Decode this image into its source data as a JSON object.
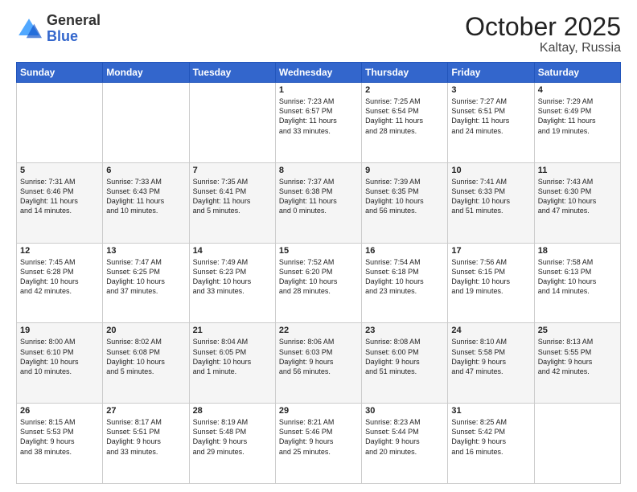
{
  "logo": {
    "general": "General",
    "blue": "Blue"
  },
  "header": {
    "month": "October 2025",
    "location": "Kaltay, Russia"
  },
  "days": [
    "Sunday",
    "Monday",
    "Tuesday",
    "Wednesday",
    "Thursday",
    "Friday",
    "Saturday"
  ],
  "weeks": [
    [
      {
        "day": "",
        "content": ""
      },
      {
        "day": "",
        "content": ""
      },
      {
        "day": "",
        "content": ""
      },
      {
        "day": "1",
        "content": "Sunrise: 7:23 AM\nSunset: 6:57 PM\nDaylight: 11 hours\nand 33 minutes."
      },
      {
        "day": "2",
        "content": "Sunrise: 7:25 AM\nSunset: 6:54 PM\nDaylight: 11 hours\nand 28 minutes."
      },
      {
        "day": "3",
        "content": "Sunrise: 7:27 AM\nSunset: 6:51 PM\nDaylight: 11 hours\nand 24 minutes."
      },
      {
        "day": "4",
        "content": "Sunrise: 7:29 AM\nSunset: 6:49 PM\nDaylight: 11 hours\nand 19 minutes."
      }
    ],
    [
      {
        "day": "5",
        "content": "Sunrise: 7:31 AM\nSunset: 6:46 PM\nDaylight: 11 hours\nand 14 minutes."
      },
      {
        "day": "6",
        "content": "Sunrise: 7:33 AM\nSunset: 6:43 PM\nDaylight: 11 hours\nand 10 minutes."
      },
      {
        "day": "7",
        "content": "Sunrise: 7:35 AM\nSunset: 6:41 PM\nDaylight: 11 hours\nand 5 minutes."
      },
      {
        "day": "8",
        "content": "Sunrise: 7:37 AM\nSunset: 6:38 PM\nDaylight: 11 hours\nand 0 minutes."
      },
      {
        "day": "9",
        "content": "Sunrise: 7:39 AM\nSunset: 6:35 PM\nDaylight: 10 hours\nand 56 minutes."
      },
      {
        "day": "10",
        "content": "Sunrise: 7:41 AM\nSunset: 6:33 PM\nDaylight: 10 hours\nand 51 minutes."
      },
      {
        "day": "11",
        "content": "Sunrise: 7:43 AM\nSunset: 6:30 PM\nDaylight: 10 hours\nand 47 minutes."
      }
    ],
    [
      {
        "day": "12",
        "content": "Sunrise: 7:45 AM\nSunset: 6:28 PM\nDaylight: 10 hours\nand 42 minutes."
      },
      {
        "day": "13",
        "content": "Sunrise: 7:47 AM\nSunset: 6:25 PM\nDaylight: 10 hours\nand 37 minutes."
      },
      {
        "day": "14",
        "content": "Sunrise: 7:49 AM\nSunset: 6:23 PM\nDaylight: 10 hours\nand 33 minutes."
      },
      {
        "day": "15",
        "content": "Sunrise: 7:52 AM\nSunset: 6:20 PM\nDaylight: 10 hours\nand 28 minutes."
      },
      {
        "day": "16",
        "content": "Sunrise: 7:54 AM\nSunset: 6:18 PM\nDaylight: 10 hours\nand 23 minutes."
      },
      {
        "day": "17",
        "content": "Sunrise: 7:56 AM\nSunset: 6:15 PM\nDaylight: 10 hours\nand 19 minutes."
      },
      {
        "day": "18",
        "content": "Sunrise: 7:58 AM\nSunset: 6:13 PM\nDaylight: 10 hours\nand 14 minutes."
      }
    ],
    [
      {
        "day": "19",
        "content": "Sunrise: 8:00 AM\nSunset: 6:10 PM\nDaylight: 10 hours\nand 10 minutes."
      },
      {
        "day": "20",
        "content": "Sunrise: 8:02 AM\nSunset: 6:08 PM\nDaylight: 10 hours\nand 5 minutes."
      },
      {
        "day": "21",
        "content": "Sunrise: 8:04 AM\nSunset: 6:05 PM\nDaylight: 10 hours\nand 1 minute."
      },
      {
        "day": "22",
        "content": "Sunrise: 8:06 AM\nSunset: 6:03 PM\nDaylight: 9 hours\nand 56 minutes."
      },
      {
        "day": "23",
        "content": "Sunrise: 8:08 AM\nSunset: 6:00 PM\nDaylight: 9 hours\nand 51 minutes."
      },
      {
        "day": "24",
        "content": "Sunrise: 8:10 AM\nSunset: 5:58 PM\nDaylight: 9 hours\nand 47 minutes."
      },
      {
        "day": "25",
        "content": "Sunrise: 8:13 AM\nSunset: 5:55 PM\nDaylight: 9 hours\nand 42 minutes."
      }
    ],
    [
      {
        "day": "26",
        "content": "Sunrise: 8:15 AM\nSunset: 5:53 PM\nDaylight: 9 hours\nand 38 minutes."
      },
      {
        "day": "27",
        "content": "Sunrise: 8:17 AM\nSunset: 5:51 PM\nDaylight: 9 hours\nand 33 minutes."
      },
      {
        "day": "28",
        "content": "Sunrise: 8:19 AM\nSunset: 5:48 PM\nDaylight: 9 hours\nand 29 minutes."
      },
      {
        "day": "29",
        "content": "Sunrise: 8:21 AM\nSunset: 5:46 PM\nDaylight: 9 hours\nand 25 minutes."
      },
      {
        "day": "30",
        "content": "Sunrise: 8:23 AM\nSunset: 5:44 PM\nDaylight: 9 hours\nand 20 minutes."
      },
      {
        "day": "31",
        "content": "Sunrise: 8:25 AM\nSunset: 5:42 PM\nDaylight: 9 hours\nand 16 minutes."
      },
      {
        "day": "",
        "content": ""
      }
    ]
  ]
}
